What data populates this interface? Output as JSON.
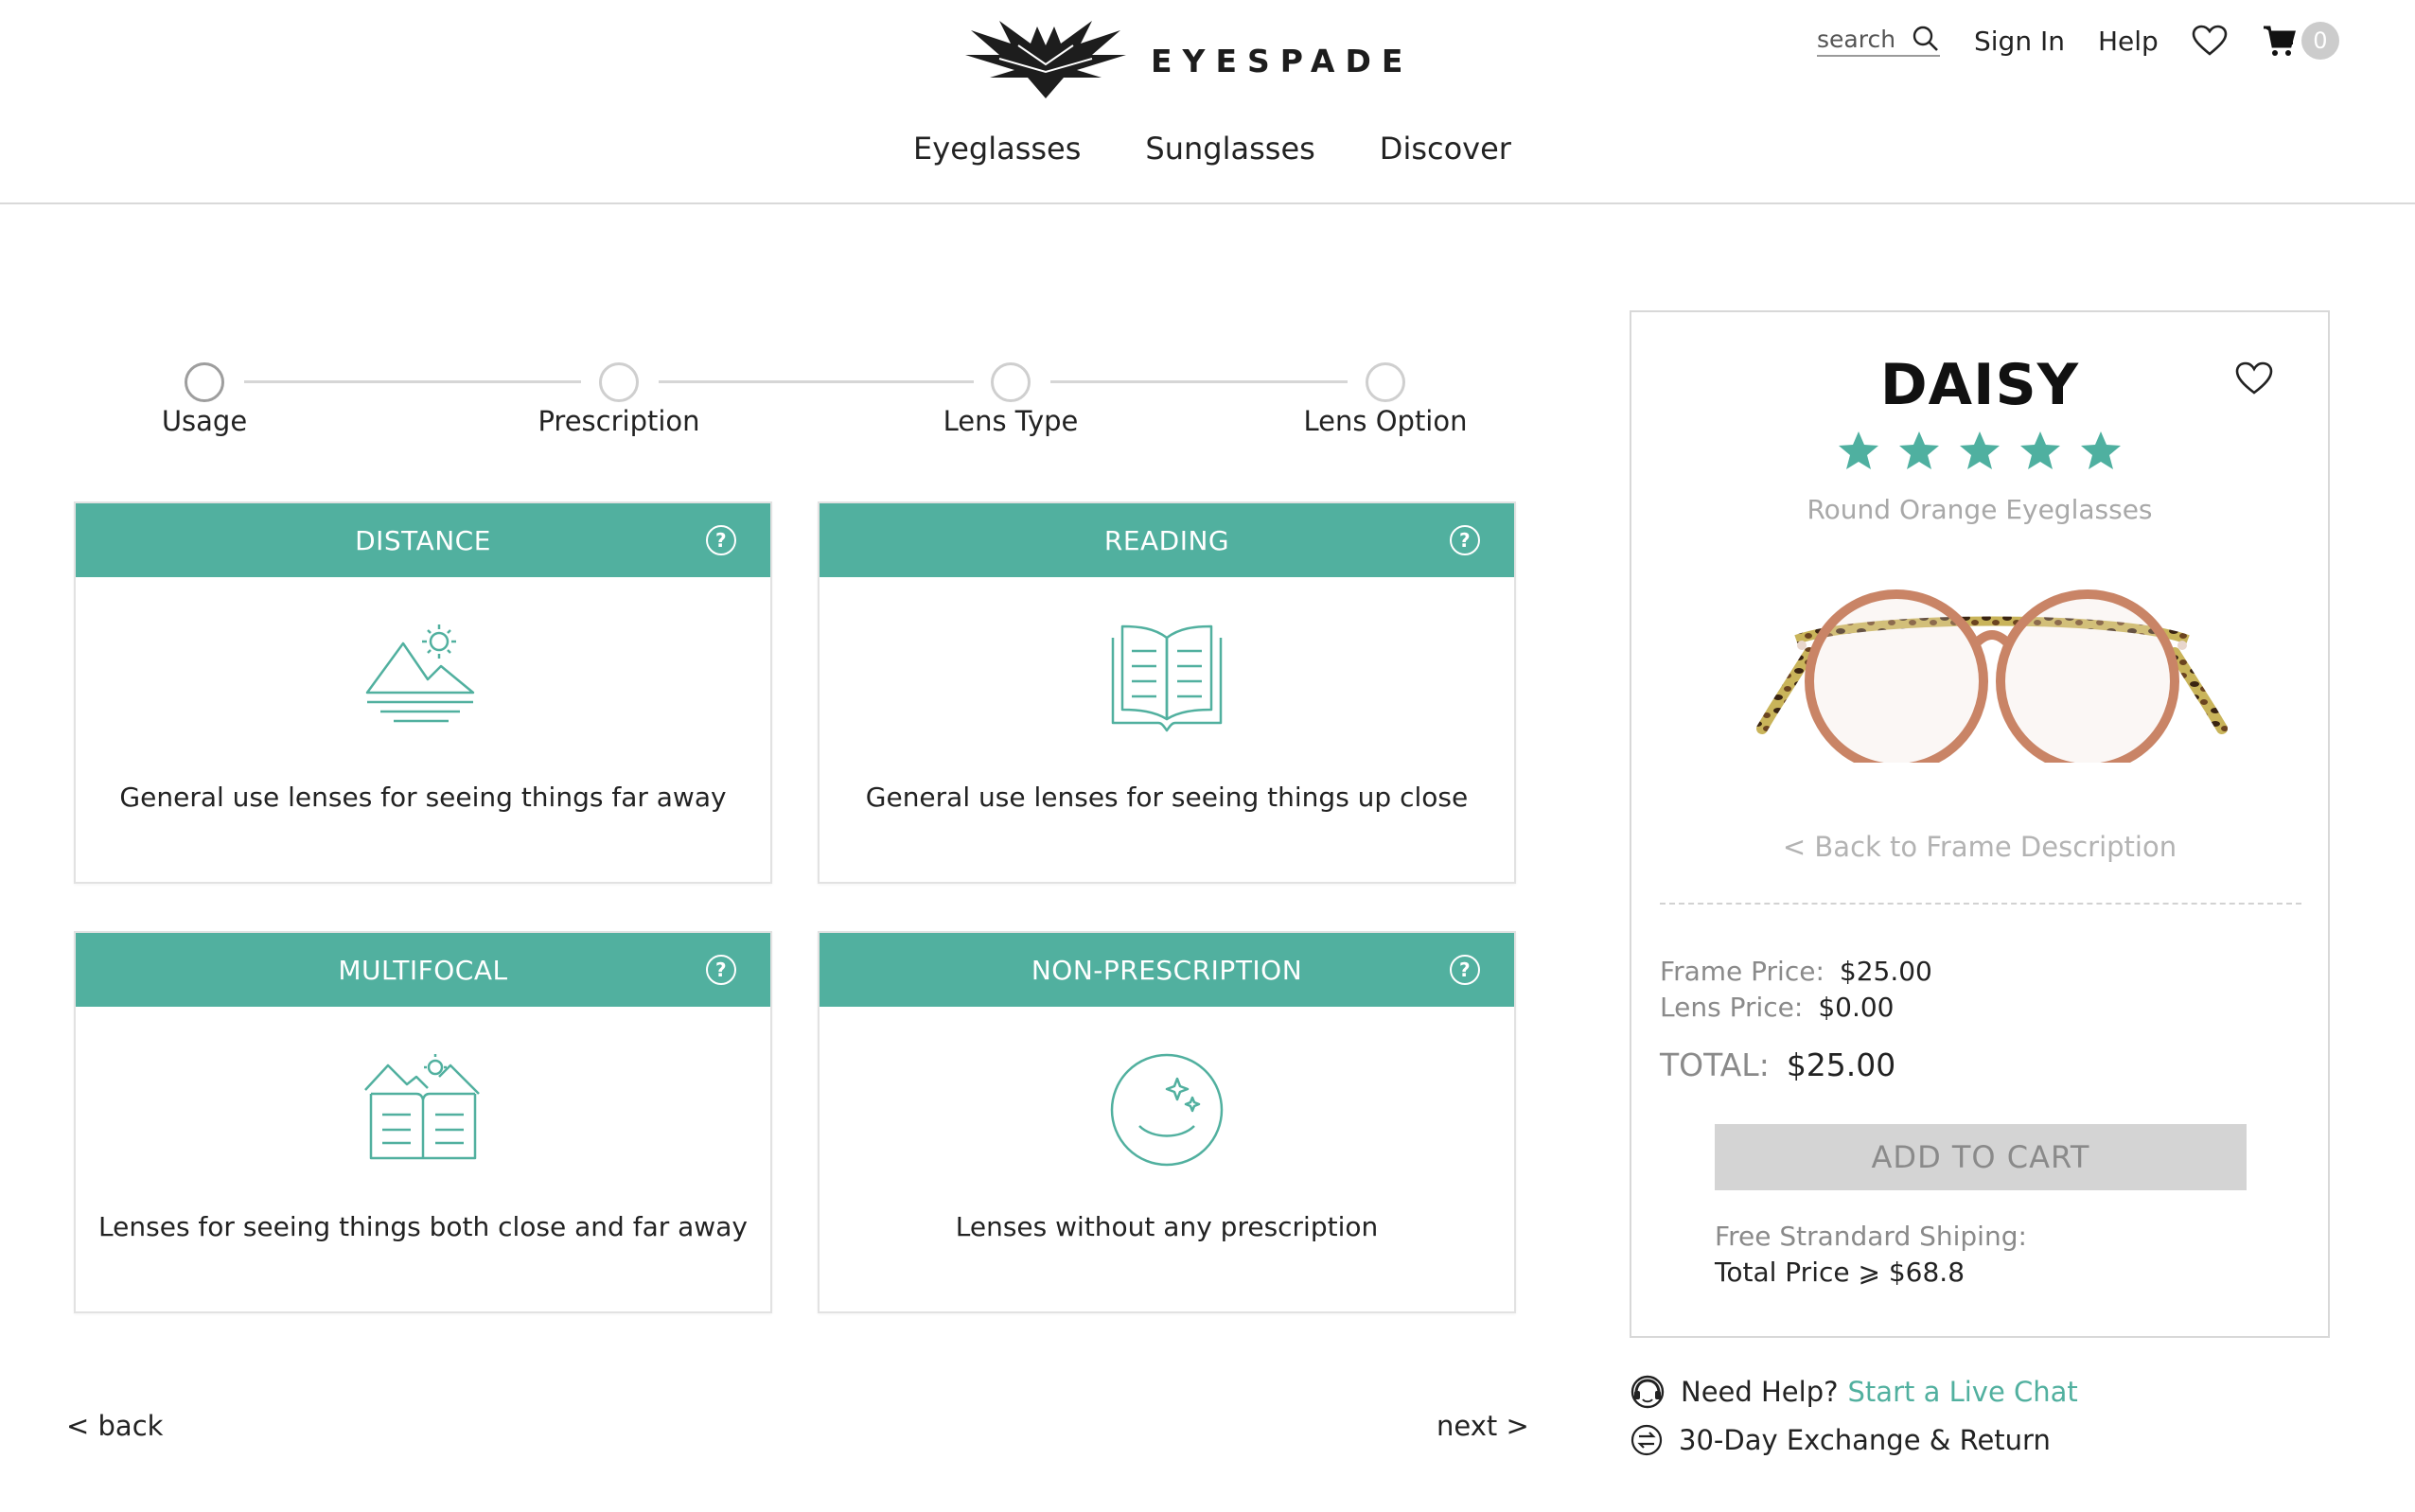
{
  "header": {
    "brand": "EYESPADE",
    "nav": [
      "Eyeglasses",
      "Sunglasses",
      "Discover"
    ],
    "search_placeholder": "search",
    "sign_in": "Sign In",
    "help": "Help",
    "cart_count": "0",
    "icons": [
      "eagle-logo-icon",
      "search-icon",
      "heart-icon",
      "cart-icon"
    ]
  },
  "steps": [
    {
      "label": "Usage",
      "active": true
    },
    {
      "label": "Prescription",
      "active": false
    },
    {
      "label": "Lens Type",
      "active": false
    },
    {
      "label": "Lens Option",
      "active": false
    }
  ],
  "options": [
    {
      "title": "DISTANCE",
      "desc": "General use lenses for seeing things far away",
      "icon": "mountain-sun-icon"
    },
    {
      "title": "READING",
      "desc": "General use lenses for seeing things up close",
      "icon": "open-book-icon"
    },
    {
      "title": "MULTIFOCAL",
      "desc": "Lenses for seeing things both close and far away",
      "icon": "book-mountain-icon"
    },
    {
      "title": "NON-PRESCRIPTION",
      "desc": "Lenses without any prescription",
      "icon": "smile-sparkle-icon"
    }
  ],
  "nav_bottom": {
    "back": "< back",
    "next": "next >"
  },
  "product": {
    "name": "DAISY",
    "rating": 5,
    "subtitle": "Round Orange Eyeglasses",
    "back_link": "<  Back to Frame Description",
    "frame_price_label": "Frame Price:",
    "frame_price": "$25.00",
    "lens_price_label": "Lens Price:",
    "lens_price": "$0.00",
    "total_label": "TOTAL:",
    "total": "$25.00",
    "add_to_cart": "ADD TO CART",
    "shipping_line1": "Free Strandard Shiping:",
    "shipping_line2": "Total Price ⩾ $68.8"
  },
  "help": {
    "need_help": "Need Help?",
    "live_chat": "Start a Live Chat",
    "exchange": "30-Day Exchange & Return"
  },
  "colors": {
    "accent": "#51b09f",
    "star": "#4fb0a0",
    "frame": "#c98466"
  }
}
